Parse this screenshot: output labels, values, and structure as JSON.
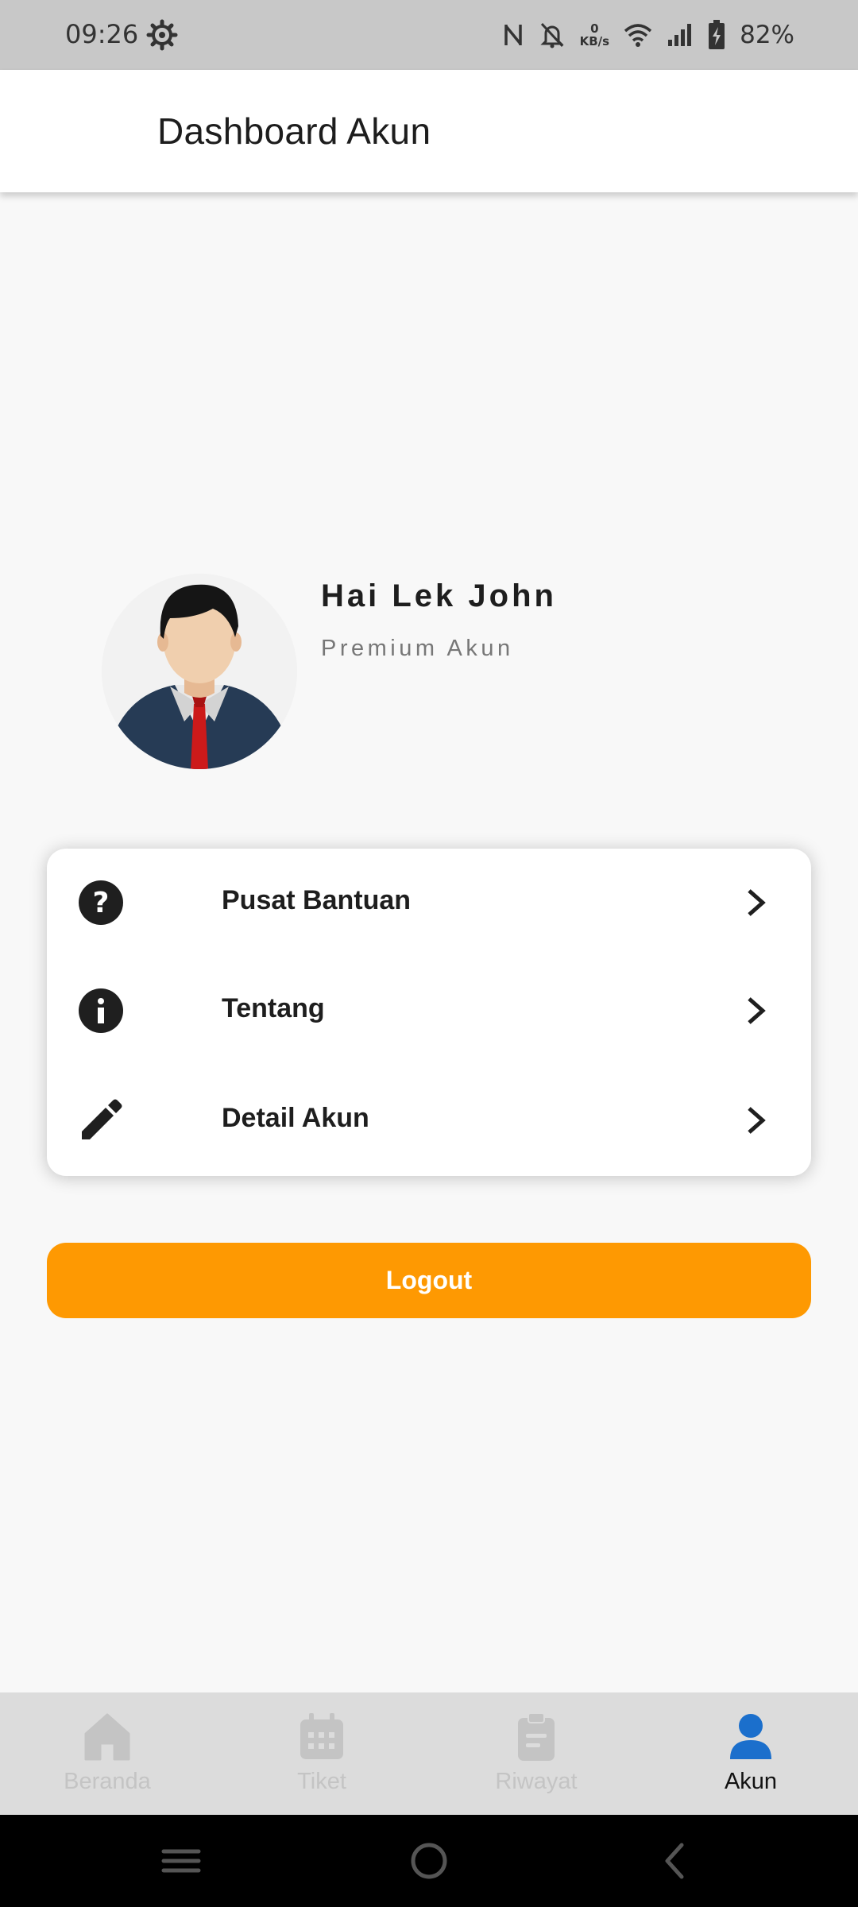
{
  "status_bar": {
    "time": "09:26",
    "speed_value": "0",
    "speed_unit": "KB/s",
    "battery": "82%",
    "icons": [
      "gear-icon",
      "nfc-icon",
      "bell-off-icon",
      "wifi-icon",
      "signal-icon",
      "battery-charging-icon"
    ]
  },
  "app_bar": {
    "title": "Dashboard Akun"
  },
  "profile": {
    "greeting": "Hai Lek John",
    "account_type": "Premium Akun",
    "avatar_icon": "avatar-icon"
  },
  "menu": {
    "items": [
      {
        "label": "Pusat Bantuan",
        "icon": "help-icon"
      },
      {
        "label": "Tentang",
        "icon": "info-icon"
      },
      {
        "label": "Detail Akun",
        "icon": "edit-icon"
      }
    ]
  },
  "logout": {
    "label": "Logout",
    "color": "#fe9902"
  },
  "bottom_nav": {
    "items": [
      {
        "label": "Beranda",
        "icon": "home-icon",
        "active": false
      },
      {
        "label": "Tiket",
        "icon": "ticket-icon",
        "active": false
      },
      {
        "label": "Riwayat",
        "icon": "clipboard-icon",
        "active": false
      },
      {
        "label": "Akun",
        "icon": "person-icon",
        "active": true
      }
    ],
    "active_color": "#1b6fcc",
    "inactive_color": "#c4c4c4"
  }
}
